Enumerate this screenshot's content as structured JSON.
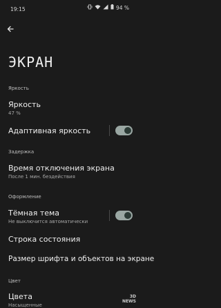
{
  "status_bar": {
    "time": "19:15",
    "battery": "94 %",
    "icons": [
      "vibrate-icon",
      "wifi-icon",
      "signal-icon",
      "battery-icon"
    ]
  },
  "page": {
    "title": "ЭКРАН"
  },
  "sections": {
    "brightness": {
      "label": "Яркость",
      "brightness_item": {
        "title": "Яркость",
        "value": "47 %"
      },
      "adaptive": {
        "title": "Адаптивная яркость",
        "enabled": true
      }
    },
    "timeout": {
      "label": "Задержка",
      "screen_timeout": {
        "title": "Время отключения экрана",
        "value": "После 1 мин. бездействия"
      }
    },
    "appearance": {
      "label": "Оформление",
      "dark_theme": {
        "title": "Тёмная тема",
        "value": "Не выключится автоматически",
        "enabled": true
      },
      "status_bar_item": {
        "title": "Строка состояния"
      },
      "font_size": {
        "title": "Размер шрифта и объектов на экране"
      }
    },
    "color": {
      "label": "Цвет",
      "colors_item": {
        "title": "Цвета",
        "value": "Насыщенные"
      }
    }
  },
  "watermark": {
    "line1": "3D",
    "line2": "NEWS"
  },
  "colors": {
    "background": "#1b1b1b",
    "toggle_track": "#9aa7a3",
    "toggle_knob": "#2b3a35"
  }
}
